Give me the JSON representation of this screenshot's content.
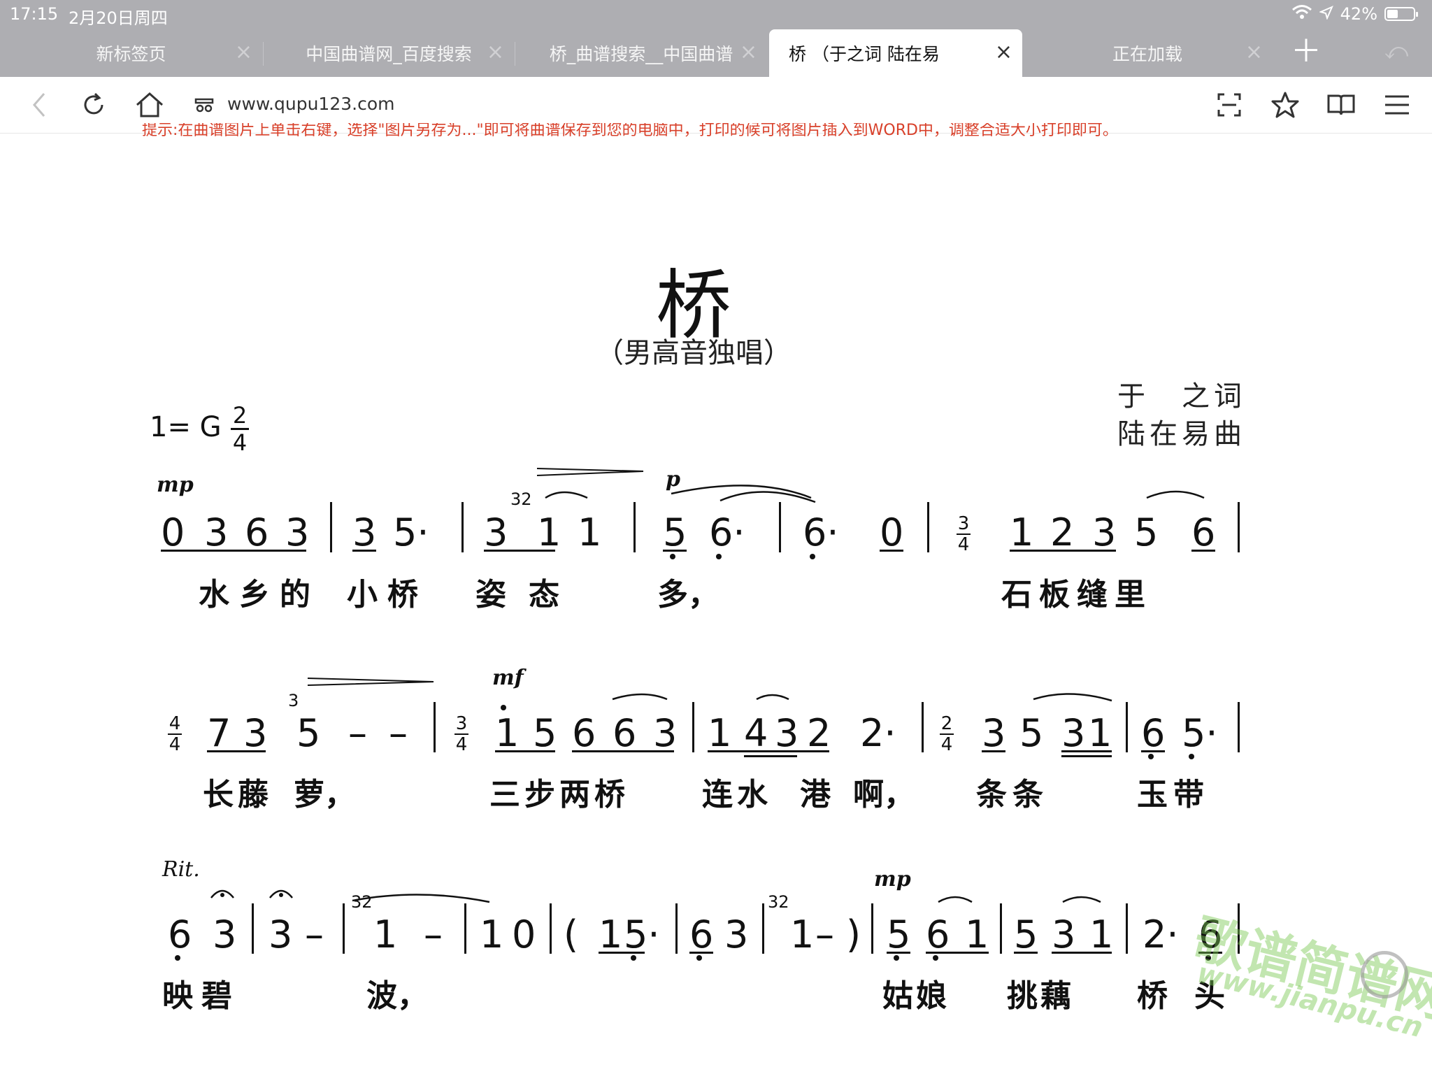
{
  "status": {
    "time": "17:15",
    "date": "2月20日周四",
    "battery": "42%",
    "battery_level": 0.42
  },
  "tabs": [
    {
      "label": "新标签页"
    },
    {
      "label": "中国曲谱网_百度搜索"
    },
    {
      "label": "桥_曲谱搜索__中国曲谱"
    },
    {
      "label": "桥 （于之词 陆在易"
    },
    {
      "label": "正在加载"
    }
  ],
  "url": "www.qupu123.com",
  "hint": "提示:在曲谱图片上单击右键，选择\"图片另存为...\"即可将曲谱保存到您的电脑中，打印的候可将图片插入到WORD中，调整合适大小打印即可。",
  "score": {
    "title": "桥",
    "subtitle": "（男高音独唱）",
    "lyricist": "于　之词",
    "composer": "陆在易曲",
    "key": "1= G",
    "ts_2_4": {
      "top": "2",
      "bottom": "4"
    },
    "ts_3_4": {
      "top": "3",
      "bottom": "4"
    },
    "ts_4_4": {
      "top": "4",
      "bottom": "4"
    },
    "dyn": {
      "mp": "mp",
      "p": "p",
      "mf": "mf",
      "rit": "Rit."
    },
    "grace32": "32",
    "grace3": "3",
    "lyrics": {
      "l1a": "水乡的",
      "l1b": "小桥",
      "l1c": "姿",
      "l1d": "态",
      "l1e": "多，",
      "l1f": "石板缝里",
      "l2a": "长藤",
      "l2b": "萝，",
      "l2c": "三步两桥",
      "l2d": "连水",
      "l2e": "港",
      "l2f": "啊，",
      "l2g": "条条",
      "l2h": "玉带",
      "l3a": "映碧",
      "l3b": "波，",
      "l3c": "姑娘",
      "l3d": "挑藕",
      "l3e": "桥",
      "l3f": "头"
    }
  },
  "watermark": {
    "text": "歌谱简谱网",
    "url": "www.jianpu.cn"
  }
}
